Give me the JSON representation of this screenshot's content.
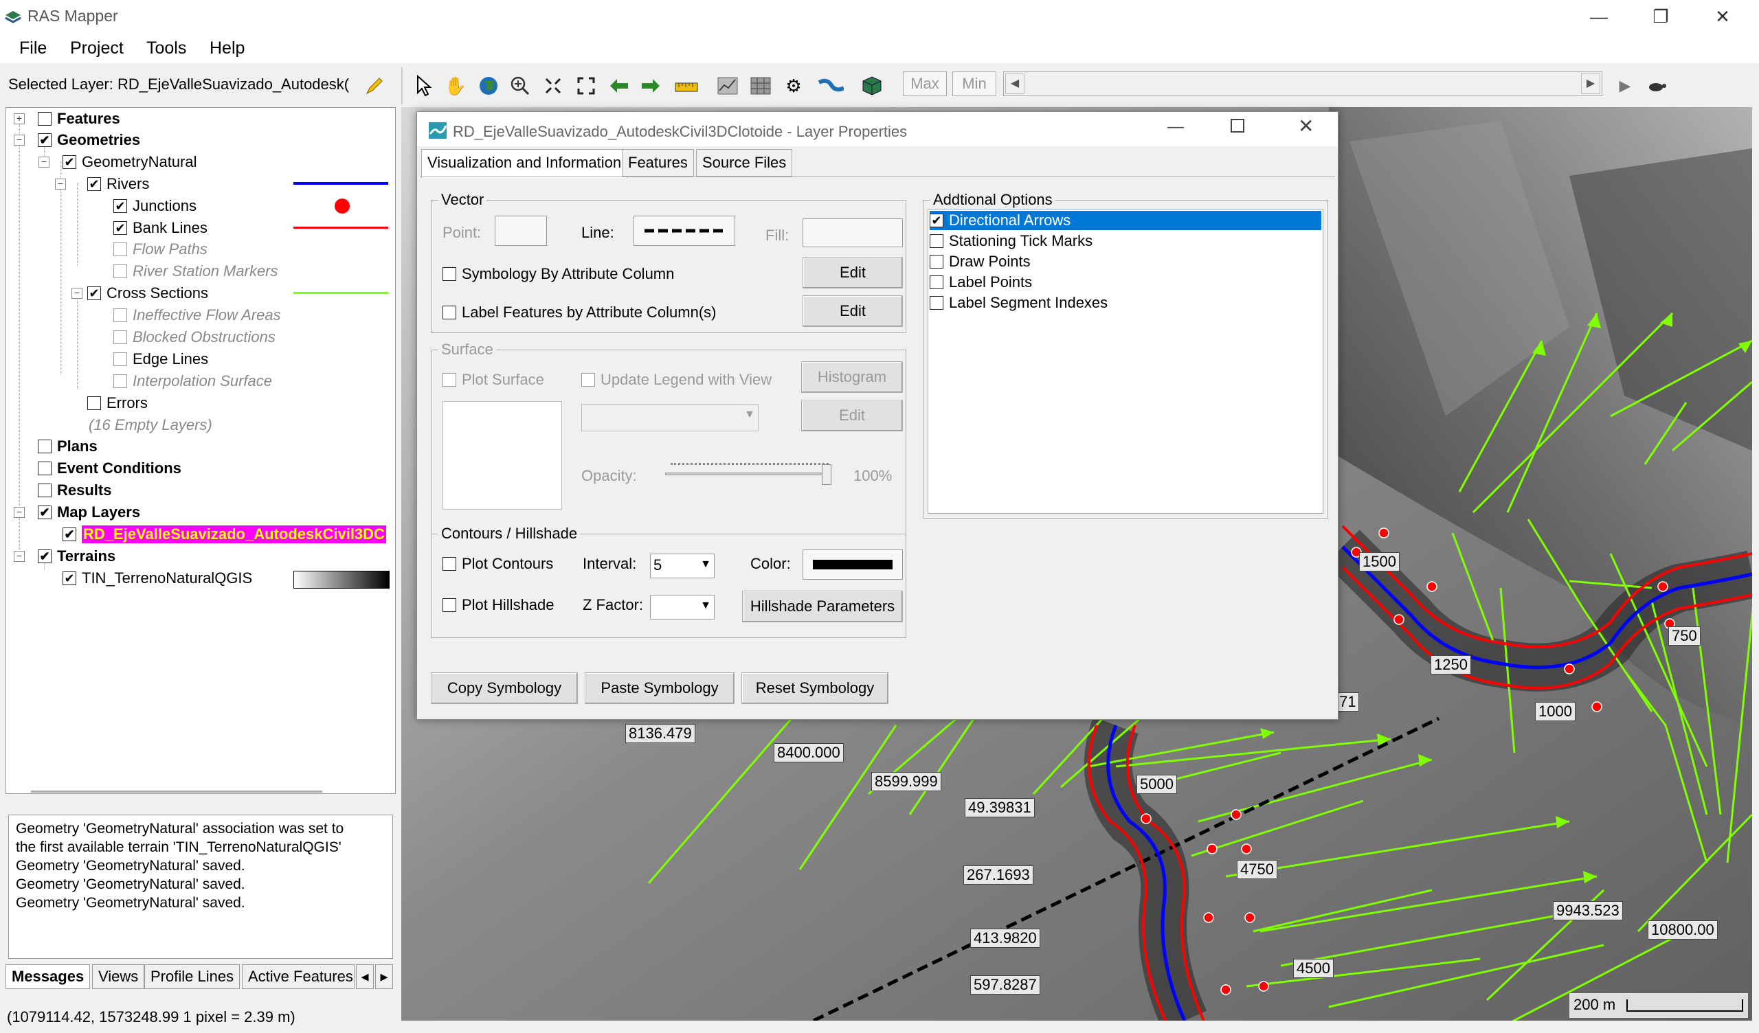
{
  "app": {
    "title": "RAS Mapper",
    "minimize": "—",
    "maximize": "❐",
    "close": "✕"
  },
  "menu": [
    "File",
    "Project",
    "Tools",
    "Help"
  ],
  "toolbar": {
    "selected_layer": "Selected Layer: RD_EjeValleSuavizado_Autodesk(",
    "max_label": "Max",
    "min_label": "Min"
  },
  "tree": {
    "features": "Features",
    "geometries": "Geometries",
    "geometry_natural": "GeometryNatural",
    "rivers": "Rivers",
    "junctions": "Junctions",
    "bank_lines": "Bank Lines",
    "flow_paths": "Flow Paths",
    "river_station_markers": "River Station Markers",
    "cross_sections": "Cross Sections",
    "ineffective_flow_areas": "Ineffective Flow Areas",
    "blocked_obstructions": "Blocked Obstructions",
    "edge_lines": "Edge Lines",
    "interpolation_surface": "Interpolation Surface",
    "errors": "Errors",
    "empty_layers": "(16 Empty Layers)",
    "plans": "Plans",
    "event_conditions": "Event Conditions",
    "results": "Results",
    "map_layers": "Map Layers",
    "rd_layer": "RD_EjeValleSuavizado_AutodeskCivil3DC",
    "terrains": "Terrains",
    "tin": "TIN_TerrenoNaturalQGIS"
  },
  "messages": [
    "Geometry 'GeometryNatural' association was set to",
    "the first available terrain 'TIN_TerrenoNaturalQGIS'",
    "Geometry 'GeometryNatural' saved.",
    "Geometry 'GeometryNatural' saved.",
    "Geometry 'GeometryNatural' saved."
  ],
  "bottom_tabs": [
    "Messages",
    "Views",
    "Profile Lines",
    "Active Features"
  ],
  "status": "(1079114.42, 1573248.99  1 pixel = 2.39 m)",
  "dialog": {
    "title": "RD_EjeValleSuavizado_AutodeskCivil3DClotoide - Layer Properties",
    "tabs": [
      "Visualization and Information",
      "Features",
      "Source Files"
    ],
    "vector": {
      "title": "Vector",
      "point": "Point:",
      "line": "Line:",
      "fill": "Fill:",
      "symbology_attr": "Symbology By Attribute Column",
      "label_features": "Label Features by Attribute Column(s)",
      "edit1": "Edit",
      "edit2": "Edit"
    },
    "surface": {
      "title": "Surface",
      "plot_surface": "Plot Surface",
      "update_legend": "Update Legend with View",
      "histogram": "Histogram",
      "edit": "Edit",
      "opacity": "Opacity:",
      "opacity_value": "100%"
    },
    "contours": {
      "title": "Contours / Hillshade",
      "plot_contours": "Plot Contours",
      "interval": "Interval:",
      "interval_value": "5",
      "color": "Color:",
      "plot_hillshade": "Plot Hillshade",
      "z_factor": "Z Factor:",
      "hillshade_params": "Hillshade Parameters"
    },
    "additional": {
      "title": "Addtional Options",
      "options": [
        "Directional Arrows",
        "Stationing Tick Marks",
        "Draw Points",
        "Label Points",
        "Label Segment Indexes"
      ],
      "checked": [
        true,
        false,
        false,
        false,
        false
      ]
    },
    "buttons": {
      "copy": "Copy Symbology",
      "paste": "Paste Symbology",
      "reset": "Reset Symbology"
    }
  },
  "map_labels": {
    "l1500": "1500",
    "l1250": "1250",
    "l1000": "1000",
    "l750": "750",
    "l71": "71",
    "l8136": "8136.479",
    "l8400": "8400.000",
    "l8599": "8599.999",
    "l49": "49.39831",
    "l5000": "5000",
    "l4750": "4750",
    "l267": "267.1693",
    "l413": "413.9820",
    "l597": "597.8287",
    "l4500": "4500",
    "l9943": "9943.523",
    "l10800": "10800.00",
    "scale": "200 m"
  },
  "colors": {
    "river": "#0000ff",
    "bank": "#ff0000",
    "xs": "#80ff00",
    "highlight": "#ff00ff",
    "selection": "#0078d7"
  }
}
